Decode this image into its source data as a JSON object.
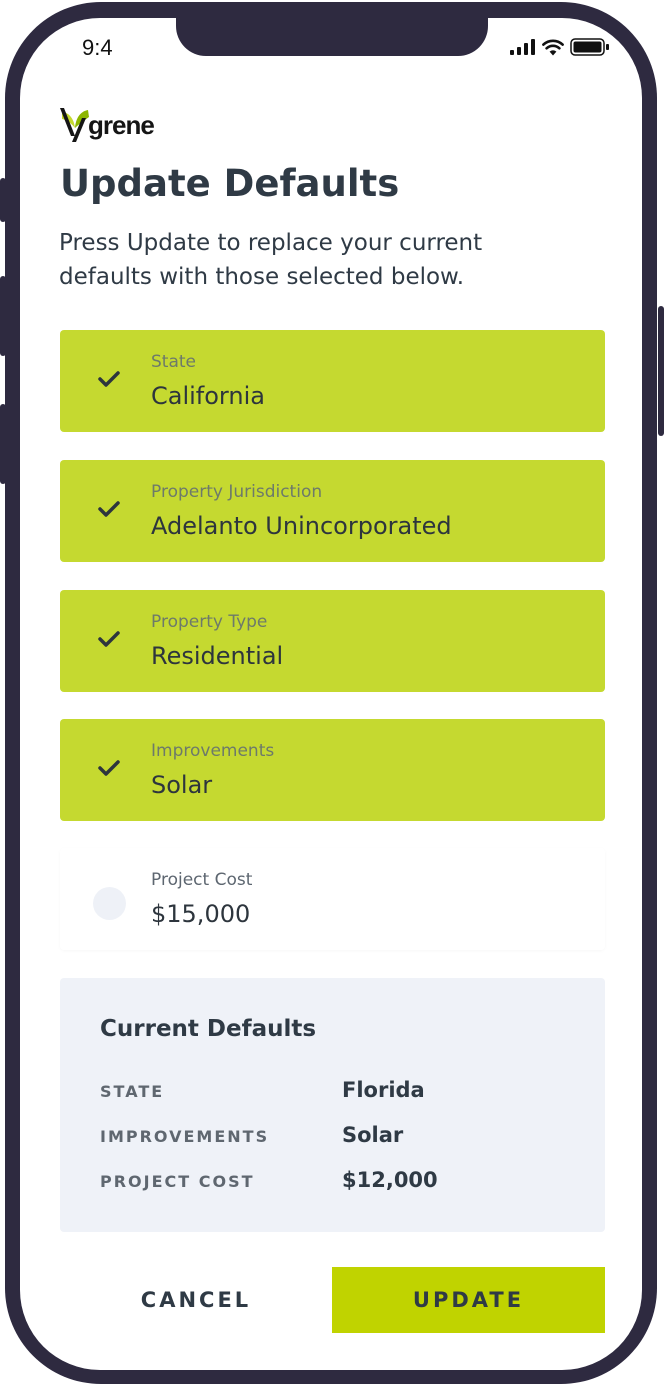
{
  "status_bar": {
    "time": "9:4"
  },
  "brand": {
    "name": "grene",
    "logo_icon": "ygrene-leaf-y-icon",
    "accent_color": "#c5d930"
  },
  "header": {
    "title": "Update Defaults",
    "subtitle": "Press Update to replace your current defaults with those selected below."
  },
  "options": [
    {
      "label": "State",
      "value": "California",
      "selected": true
    },
    {
      "label": "Property Jurisdiction",
      "value": "Adelanto Unincorporated",
      "selected": true
    },
    {
      "label": "Property Type",
      "value": "Residential",
      "selected": true
    },
    {
      "label": "Improvements",
      "value": "Solar",
      "selected": true
    },
    {
      "label": "Project Cost",
      "value": "$15,000",
      "selected": false
    }
  ],
  "current_defaults": {
    "title": "Current Defaults",
    "rows": [
      {
        "key": "STATE",
        "value": "Florida"
      },
      {
        "key": "IMPROVEMENTS",
        "value": "Solar"
      },
      {
        "key": "PROJECT COST",
        "value": "$12,000"
      }
    ]
  },
  "actions": {
    "cancel_label": "CANCEL",
    "update_label": "UPDATE",
    "update_color": "#c0d300"
  }
}
